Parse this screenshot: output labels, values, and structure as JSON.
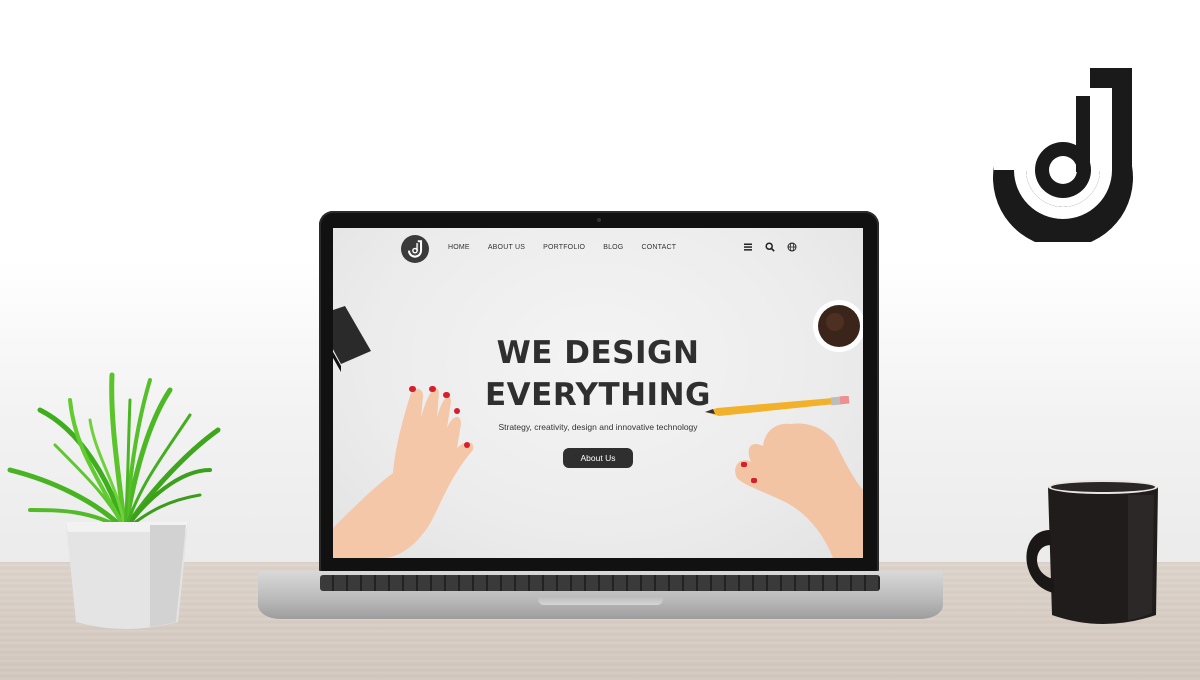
{
  "colors": {
    "accent": "#2f2f2f",
    "background": "#ffffff",
    "desk": "#d8cec5"
  },
  "brand": {
    "logo_icon": "j-logo-icon"
  },
  "website": {
    "logo_icon": "j-logo-icon",
    "nav": [
      {
        "label": "HOME"
      },
      {
        "label": "ABOUT US"
      },
      {
        "label": "PORTFOLIO"
      },
      {
        "label": "BLOG"
      },
      {
        "label": "CONTACT"
      }
    ],
    "nav_icons": [
      "menu-icon",
      "search-icon",
      "globe-icon"
    ],
    "hero": {
      "title_line1": "WE DESIGN",
      "title_line2": "EVERYTHING",
      "subtitle": "Strategy, creativity, design and innovative technology",
      "cta_label": "About Us"
    }
  }
}
